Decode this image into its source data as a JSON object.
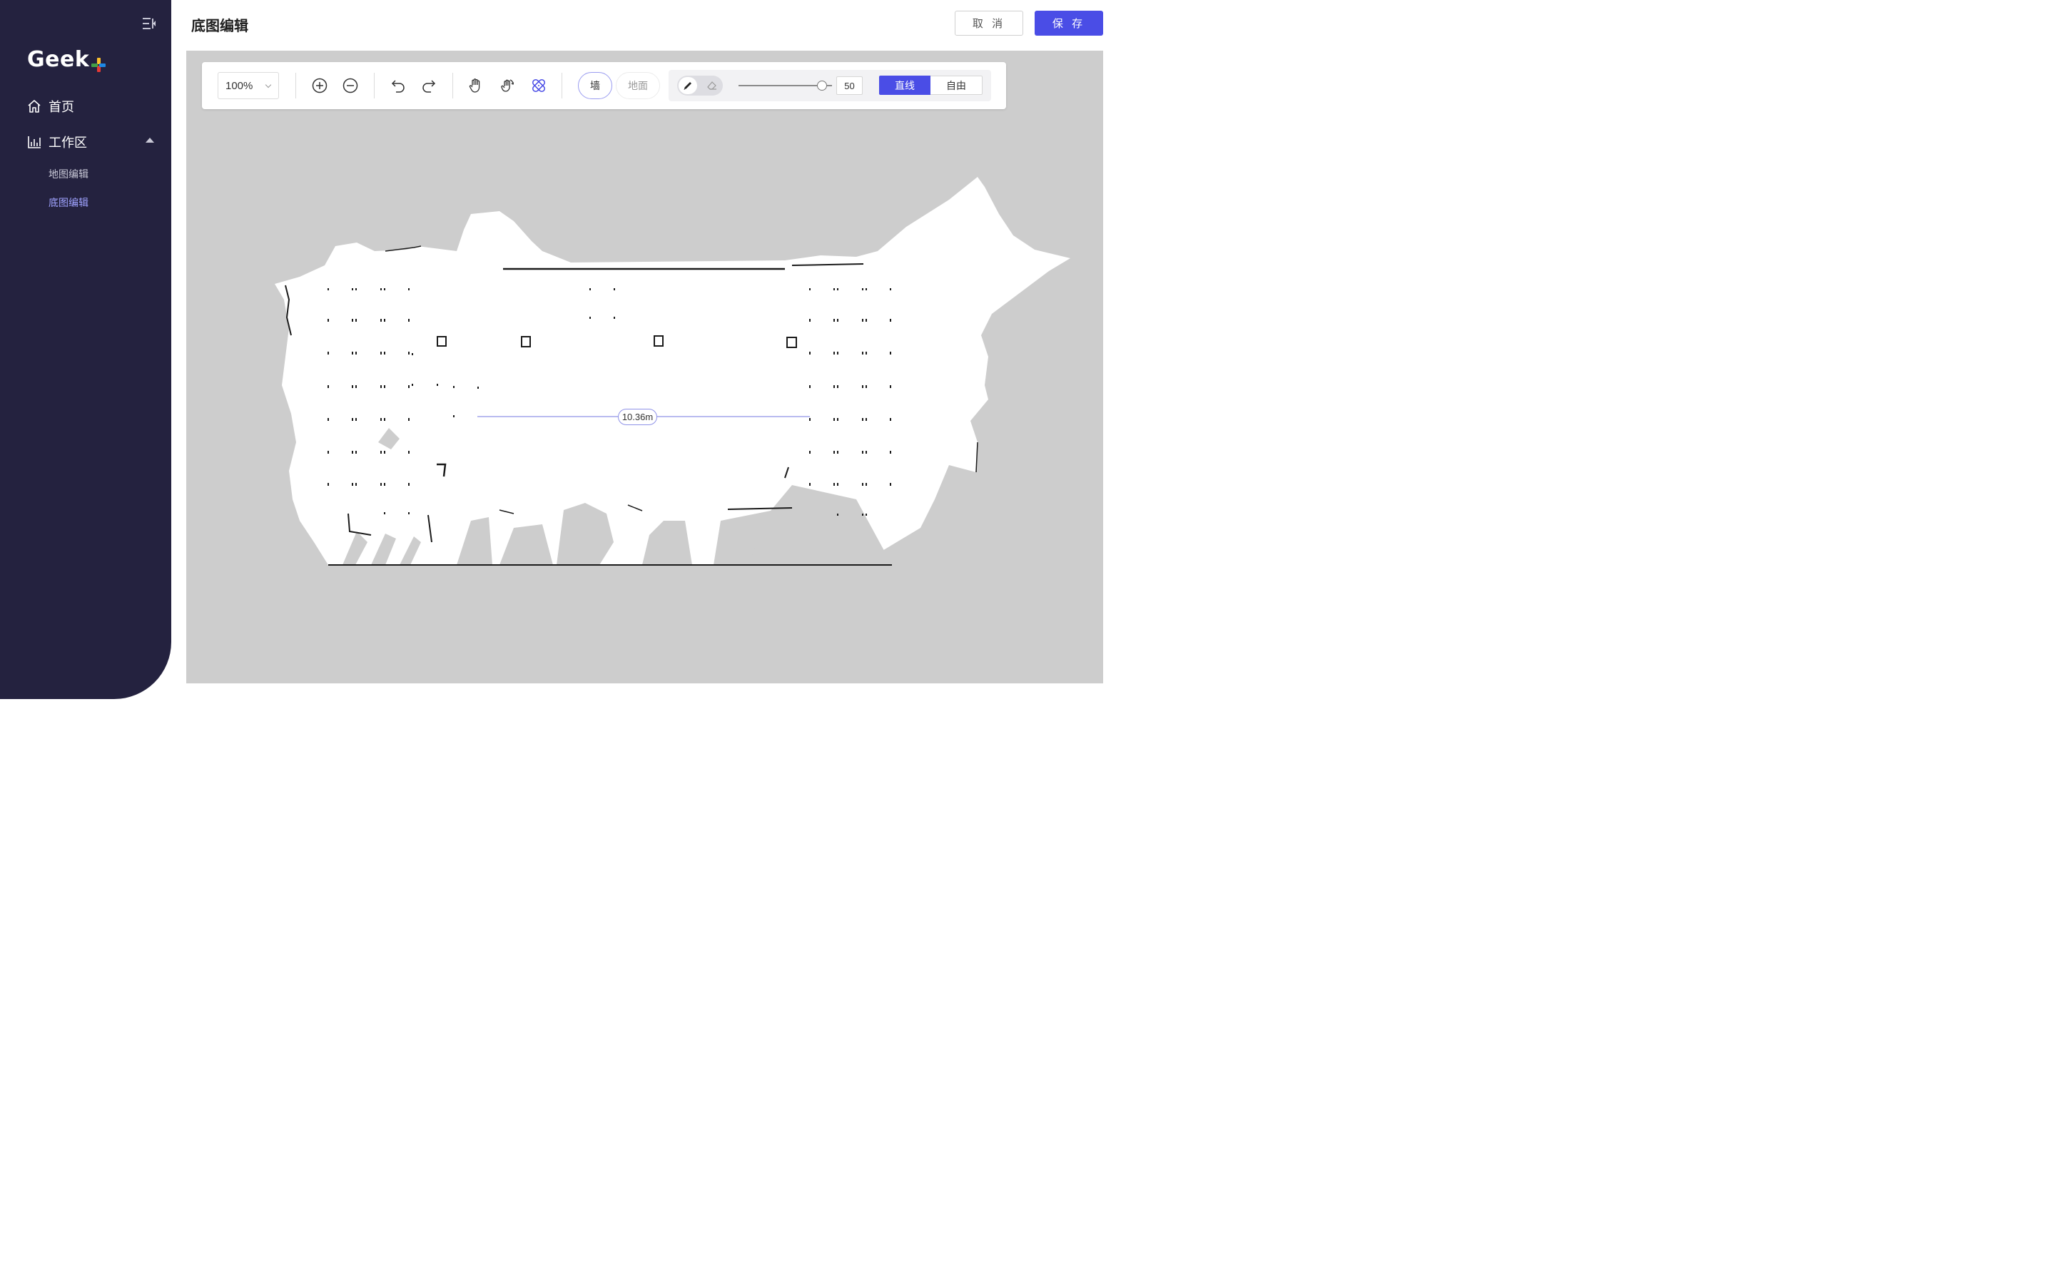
{
  "sidebar": {
    "logo_text": "Geek",
    "logo_colors": [
      "#e53935",
      "#fbc02d",
      "#43a047",
      "#1e88e5"
    ],
    "nav": {
      "home_label": "首页",
      "workspace_label": "工作区",
      "sub_items": [
        {
          "label": "地图编辑",
          "active": false
        },
        {
          "label": "底图编辑",
          "active": true
        }
      ]
    }
  },
  "header": {
    "title": "底图编辑",
    "cancel_label": "取 消",
    "save_label": "保 存"
  },
  "toolbar": {
    "zoom_value": "100%",
    "wall_label": "墙",
    "floor_label": "地面",
    "brush_size": "50",
    "line_mode_label": "直线",
    "free_mode_label": "自由",
    "selected_mode": "直线",
    "selected_layer": "墙",
    "selected_tool": "pen"
  },
  "canvas": {
    "measurement_label": "10.36m",
    "colors": {
      "background": "#cdcdcd",
      "free_space": "#ffffff",
      "obstacle": "#1a1a1a",
      "measure_line": "#8f92e8"
    }
  },
  "colors": {
    "sidebar_bg": "#24223f",
    "primary": "#4a4de6",
    "active_sub_item": "#9fa3ff"
  }
}
